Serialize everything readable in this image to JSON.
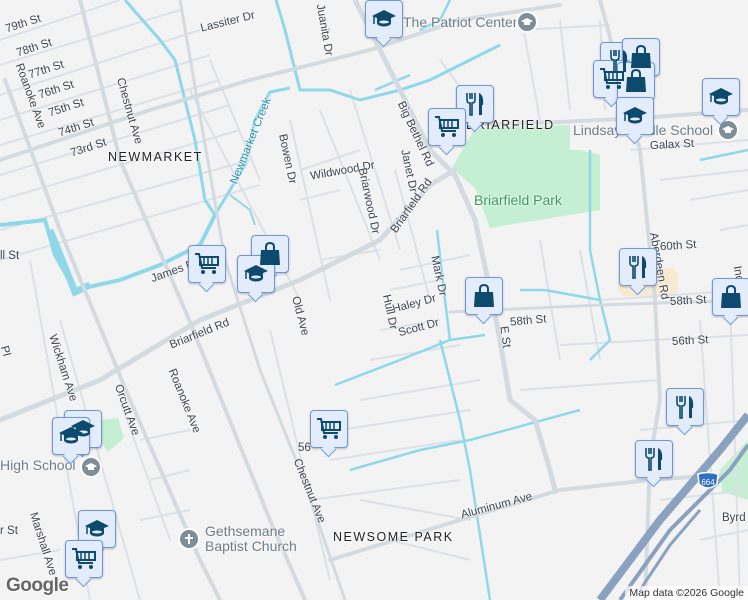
{
  "map": {
    "colors": {
      "background": "#f4f3f4",
      "road": "#d3dbe1",
      "water": "#8fd8ea",
      "park": "#c4efd3",
      "highway": "#8aa2bf",
      "marker_bg": "#e3ecfb",
      "marker_icon": "#0d4a6e"
    },
    "areas": [
      "NEWMARKET",
      "BRIARFIELD",
      "NEWSOME PARK"
    ],
    "streets": [
      "79th St",
      "78th St",
      "77th St",
      "76th St",
      "75th St",
      "74th St",
      "73rd St",
      "Roanoke Ave",
      "Chestnut Ave",
      "Lassiter Dr",
      "Juanita Dr",
      "Bowen Dr",
      "Wildwood Dr",
      "Briarwood Dr",
      "Big Bethel Rd",
      "Janet Dr",
      "Briarfield Rd",
      "Galax St",
      "Aberdeen Rd",
      "60th St",
      "Mark Dr",
      "Haley Dr",
      "Hull Dr",
      "Scott Dr",
      "E St",
      "58th St",
      "58th St",
      "56th St",
      "James Dr",
      "Old Ave",
      "Briarfield Rd",
      "Wickham Ave",
      "Orcutt Ave",
      "Roanoke Ave",
      "Chestnut Ave",
      "Marshall Ave",
      "Aluminum Ave",
      "Byrd St",
      "Ind",
      "ll St",
      "Pl",
      "r St",
      "56"
    ],
    "water": [
      "Newmarket Creek"
    ],
    "parks": [
      "Briarfield Park"
    ],
    "pois": [
      "The Patriot Center",
      "Lindsay Middle School",
      "High School",
      "Gethsemane Baptist Church"
    ],
    "highway_shield": "664",
    "attribution": "Map data ©2026 Google",
    "logo": "Google"
  }
}
